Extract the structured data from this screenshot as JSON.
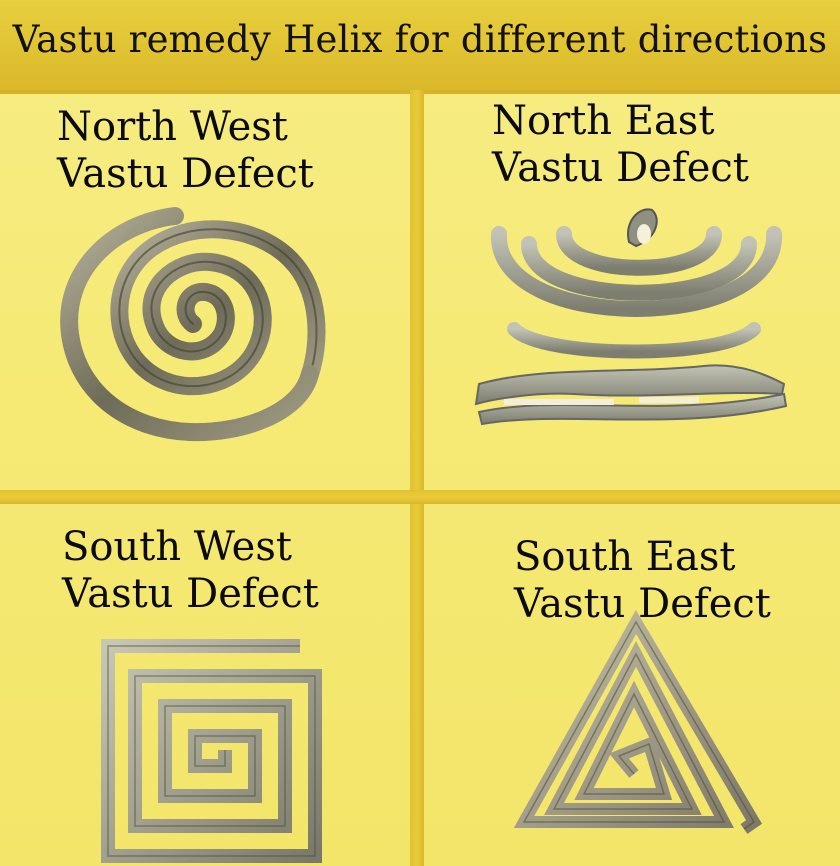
{
  "title": "Vastu remedy Helix for different directions",
  "panels": [
    {
      "line1": "North West",
      "line2": "Vastu Defect",
      "helix_icon": "spiral-helix"
    },
    {
      "line1": "North East",
      "line2": "Vastu Defect",
      "helix_icon": "crescent-flame-helix"
    },
    {
      "line1": "South West",
      "line2": "Vastu Defect",
      "helix_icon": "square-spiral-helix"
    },
    {
      "line1": "South East",
      "line2": "Vastu Defect",
      "helix_icon": "triangle-spiral-helix"
    }
  ],
  "colors": {
    "background": "#f3e66a",
    "header": "#e1c332",
    "metal": "#8a8a78"
  }
}
